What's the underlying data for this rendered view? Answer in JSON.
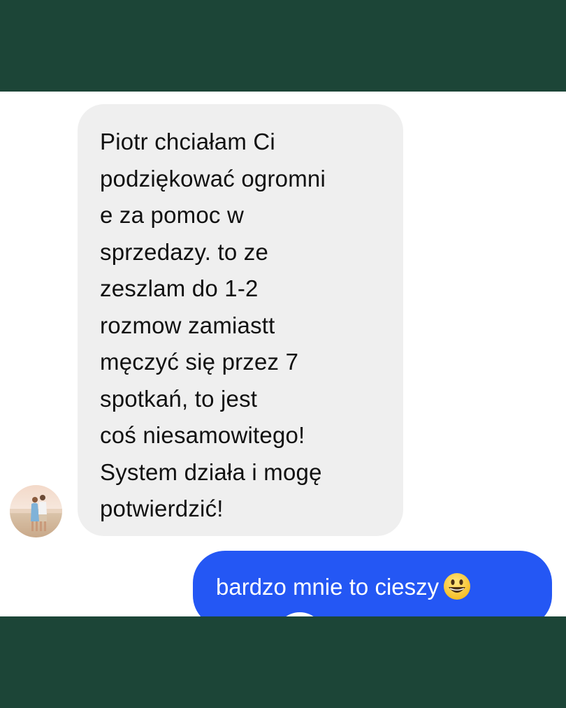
{
  "conversation": {
    "incoming_message": {
      "text": "Piotr chciałam Ci\npodziękować ogromni\ne za pomoc w\nsprzedazy. to ze\nzeszlam do 1-2\nrozmow zamiastt\nmęczyć się przez 7\nspotkań, to jest\ncoś niesamowitego!\nSystem działa i mogę\npotwierdzić!"
    },
    "outgoing_message": {
      "text": "bardzo mnie to cieszy",
      "emoji": "grinning-face-emoji"
    }
  },
  "colors": {
    "frame": "#1c4537",
    "chat_background": "#ffffff",
    "incoming_bubble": "#efefef",
    "outgoing_bubble": "#2457f4"
  }
}
